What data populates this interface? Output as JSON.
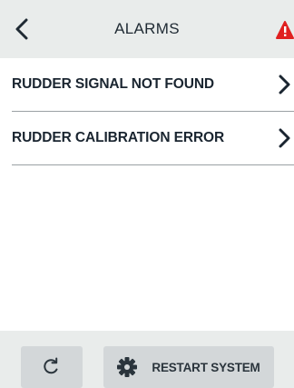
{
  "header": {
    "title": "ALARMS",
    "back_icon": "chevron-left-icon",
    "warning_icon": "warning-triangle-icon",
    "warning_color": "#e02020"
  },
  "alarms": [
    {
      "label": "RUDDER SIGNAL NOT FOUND",
      "icon": "chevron-right-icon"
    },
    {
      "label": "RUDDER CALIBRATION ERROR",
      "icon": "chevron-right-icon"
    }
  ],
  "footer": {
    "refresh_icon": "refresh-icon",
    "restart_icon": "gear-icon",
    "restart_label": "RESTART SYSTEM"
  },
  "colors": {
    "bar_background": "#e9eceb",
    "button_background": "#d3d7d9",
    "text": "#1f2a33"
  }
}
